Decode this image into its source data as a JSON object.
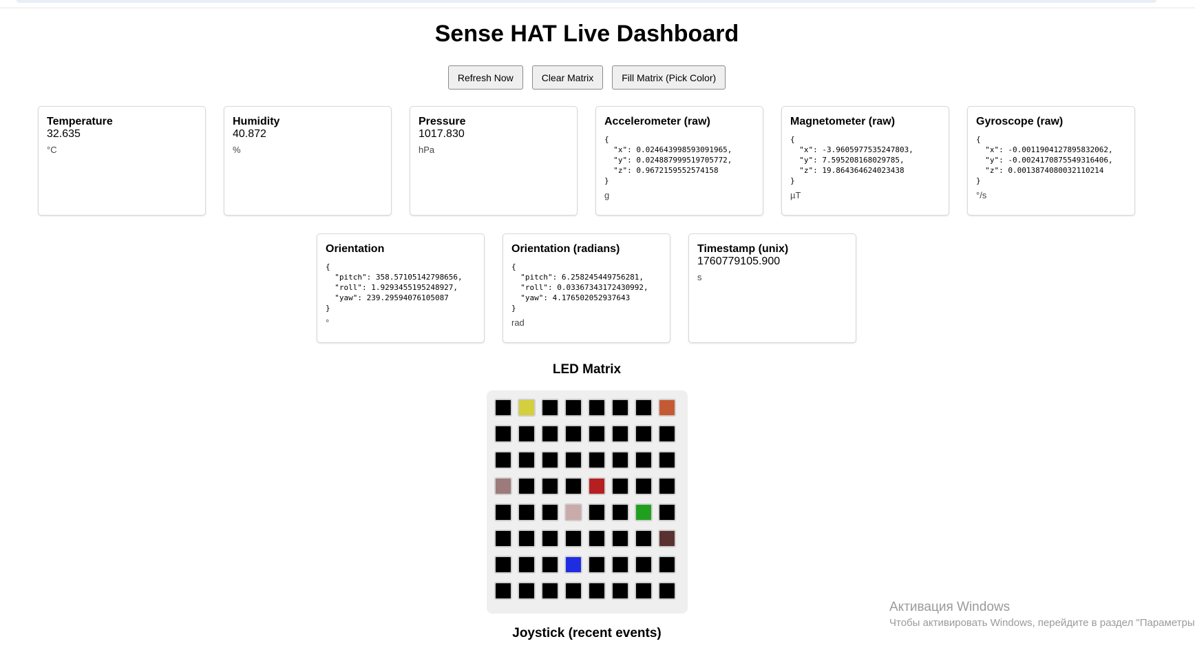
{
  "header": {
    "title": "Sense HAT Live Dashboard"
  },
  "toolbar": {
    "refresh_label": "Refresh Now",
    "clear_label": "Clear Matrix",
    "fill_label": "Fill Matrix (Pick Color)"
  },
  "cards": {
    "temperature": {
      "title": "Temperature",
      "value": "32.635",
      "unit": "°C"
    },
    "humidity": {
      "title": "Humidity",
      "value": "40.872",
      "unit": "%"
    },
    "pressure": {
      "title": "Pressure",
      "value": "1017.830",
      "unit": "hPa"
    },
    "accelerometer": {
      "title": "Accelerometer (raw)",
      "json": "{\n  \"x\": 0.024643998593091965,\n  \"y\": 0.024887999519705772,\n  \"z\": 0.9672159552574158\n}",
      "unit": "g"
    },
    "magnetometer": {
      "title": "Magnetometer (raw)",
      "json": "{\n  \"x\": -3.9605977535247803,\n  \"y\": 7.595208168029785,\n  \"z\": 19.864364624023438\n}",
      "unit": "µT"
    },
    "gyroscope": {
      "title": "Gyroscope (raw)",
      "json": "{\n  \"x\": -0.0011904127895832062,\n  \"y\": -0.0024170875549316406,\n  \"z\": 0.0013874080032110214\n}",
      "unit": "°/s"
    },
    "orientation": {
      "title": "Orientation",
      "json": "{\n  \"pitch\": 358.57105142798656,\n  \"roll\": 1.9293455195248927,\n  \"yaw\": 239.29594076105087\n}",
      "unit": "°"
    },
    "orientation_rad": {
      "title": "Orientation (radians)",
      "json": "{\n  \"pitch\": 6.258245449756281,\n  \"roll\": 0.03367343172430992,\n  \"yaw\": 4.176502052937643\n}",
      "unit": "rad"
    },
    "timestamp": {
      "title": "Timestamp (unix)",
      "value": "1760779105.900",
      "unit": "s"
    }
  },
  "led_matrix": {
    "title": "LED Matrix",
    "pixels": [
      [
        "#000000",
        "#d4cf3c",
        "#000000",
        "#000000",
        "#000000",
        "#000000",
        "#000000",
        "#c45a34"
      ],
      [
        "#000000",
        "#000000",
        "#000000",
        "#000000",
        "#000000",
        "#000000",
        "#000000",
        "#000000"
      ],
      [
        "#000000",
        "#000000",
        "#000000",
        "#000000",
        "#000000",
        "#000000",
        "#000000",
        "#000000"
      ],
      [
        "#9d7a7b",
        "#000000",
        "#000000",
        "#000000",
        "#b51f21",
        "#000000",
        "#000000",
        "#000000"
      ],
      [
        "#000000",
        "#000000",
        "#000000",
        "#c9aba9",
        "#000000",
        "#000000",
        "#21a020",
        "#000000"
      ],
      [
        "#000000",
        "#000000",
        "#000000",
        "#000000",
        "#000000",
        "#000000",
        "#000000",
        "#5b3130"
      ],
      [
        "#000000",
        "#000000",
        "#000000",
        "#1f2de0",
        "#000000",
        "#000000",
        "#000000",
        "#000000"
      ],
      [
        "#000000",
        "#000000",
        "#000000",
        "#000000",
        "#000000",
        "#000000",
        "#000000",
        "#000000"
      ]
    ]
  },
  "joystick": {
    "title": "Joystick (recent events)"
  },
  "watermark": {
    "title": "Активация Windows",
    "subtitle": "Чтобы активировать Windows, перейдите в раздел \"Параметры\""
  }
}
